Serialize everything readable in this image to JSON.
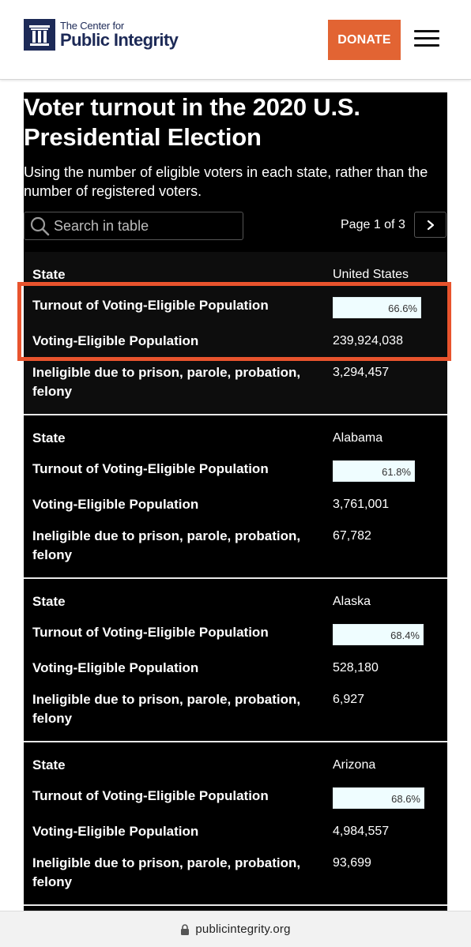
{
  "header": {
    "logo_line1": "The Center for",
    "logo_line2": "Public Integrity",
    "donate_label": "DONATE",
    "menu_icon": "hamburger-icon"
  },
  "widget": {
    "title": "Voter turnout in the 2020 U.S. Presidential Election",
    "subtitle": "Using the number of eligible voters in each state, rather than the number of registered voters.",
    "search_placeholder": "Search in table",
    "pager": "Page 1 of 3",
    "next_icon": "chevron-right-icon"
  },
  "labels": {
    "state": "State",
    "turnout": "Turnout of Voting-Eligible Population",
    "vep": "Voting-Eligible Population",
    "ineligible": "Ineligible due to prison, parole, probation, felony"
  },
  "records": [
    {
      "state": "United States",
      "turnout": "66.6%",
      "turnout_value": 66.6,
      "vep": "239,924,038",
      "ineligible": "3,294,457"
    },
    {
      "state": "Alabama",
      "turnout": "61.8%",
      "turnout_value": 61.8,
      "vep": "3,761,001",
      "ineligible": "67,782"
    },
    {
      "state": "Alaska",
      "turnout": "68.4%",
      "turnout_value": 68.4,
      "vep": "528,180",
      "ineligible": "6,927"
    },
    {
      "state": "Arizona",
      "turnout": "68.6%",
      "turnout_value": 68.6,
      "vep": "4,984,557",
      "ineligible": "93,699"
    }
  ],
  "colors": {
    "accent": "#e26433",
    "highlight": "#e8532d",
    "brand_navy": "#1d2a57",
    "bar_fill": "#effdff"
  },
  "browser": {
    "url": "publicintegrity.org",
    "lock_icon": "lock-icon"
  }
}
